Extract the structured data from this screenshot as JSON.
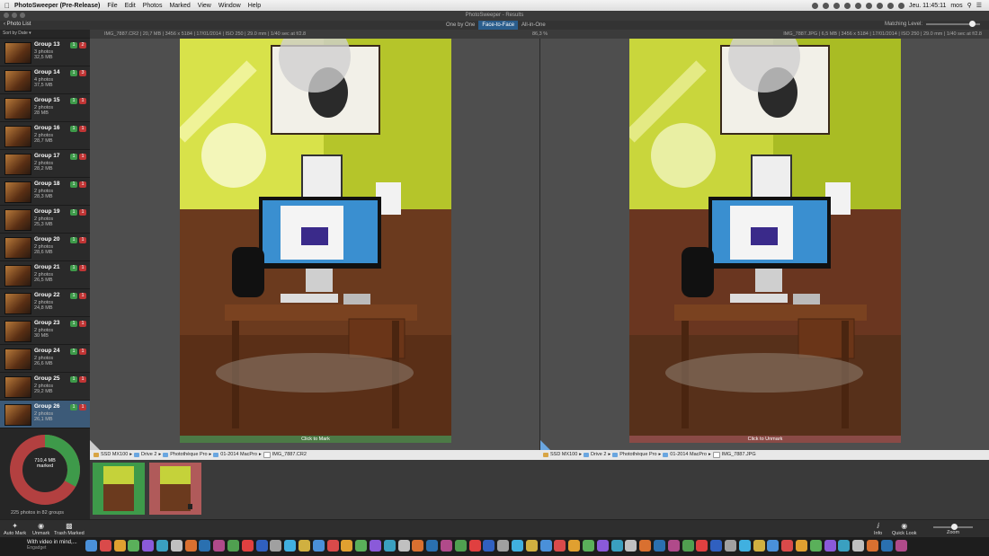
{
  "menubar": {
    "app_name": "PhotoSweeper (Pre-Release)",
    "items": [
      "File",
      "Edit",
      "Photos",
      "Marked",
      "View",
      "Window",
      "Help"
    ],
    "clock": "Jeu. 11:45:11",
    "user": "mos"
  },
  "window": {
    "title": "PhotoSweeper - Results"
  },
  "toolbar": {
    "back_label": "Photo List",
    "modes": [
      "One by One",
      "Face-to-Face",
      "All-in-One"
    ],
    "active_mode": "Face-to-Face",
    "matching_label": "Matching Level:",
    "matching_level": 0.85
  },
  "sidebar": {
    "sort_label": "Sort by Date",
    "groups": [
      {
        "name": "Group 13",
        "count": "3 photos",
        "size": "32,5 MB",
        "keep": "1",
        "trash": "2"
      },
      {
        "name": "Group 14",
        "count": "4 photos",
        "size": "37,5 MB",
        "keep": "1",
        "trash": "3"
      },
      {
        "name": "Group 15",
        "count": "2 photos",
        "size": "28 MB",
        "keep": "1",
        "trash": "1"
      },
      {
        "name": "Group 16",
        "count": "2 photos",
        "size": "28,7 MB",
        "keep": "1",
        "trash": "1"
      },
      {
        "name": "Group 17",
        "count": "2 photos",
        "size": "28,2 MB",
        "keep": "1",
        "trash": "1"
      },
      {
        "name": "Group 18",
        "count": "2 photos",
        "size": "28,3 MB",
        "keep": "1",
        "trash": "1"
      },
      {
        "name": "Group 19",
        "count": "2 photos",
        "size": "25,3 MB",
        "keep": "1",
        "trash": "1"
      },
      {
        "name": "Group 20",
        "count": "2 photos",
        "size": "28,6 MB",
        "keep": "1",
        "trash": "1"
      },
      {
        "name": "Group 21",
        "count": "2 photos",
        "size": "26,5 MB",
        "keep": "1",
        "trash": "1"
      },
      {
        "name": "Group 22",
        "count": "2 photos",
        "size": "24,8 MB",
        "keep": "1",
        "trash": "1"
      },
      {
        "name": "Group 23",
        "count": "2 photos",
        "size": "30 MB",
        "keep": "1",
        "trash": "1"
      },
      {
        "name": "Group 24",
        "count": "2 photos",
        "size": "26,6 MB",
        "keep": "1",
        "trash": "1"
      },
      {
        "name": "Group 25",
        "count": "2 photos",
        "size": "29,2 MB",
        "keep": "1",
        "trash": "1"
      },
      {
        "name": "Group 26",
        "count": "2 photos",
        "size": "26,1 MB",
        "keep": "1",
        "trash": "1"
      }
    ],
    "selected_group": "Group 26",
    "marked_size": "710,4 MB",
    "marked_label": "marked",
    "marked_fraction": 0.33,
    "footer": "225 photos in 82 groups"
  },
  "infobar": {
    "left": "IMG_7887.CR2 | 20,7 MB | 3456 x 5184 | 17/01/2014 | ISO 250 | 29.0 mm | 1/40 sec at f/2.8",
    "zoom": "86,3 %",
    "right": "IMG_7887.JPG | 6,5 MB | 3456 x 5184 | 17/01/2014 | ISO 250 | 29.0 mm | 1/40 sec at f/2.8"
  },
  "panes": {
    "left_action": "Click to Mark",
    "right_action": "Click to Unmark"
  },
  "path_left": [
    "SSD MX100",
    "Drive 2",
    "Photothèque Pro",
    "01-2014 MacPro",
    "IMG_7887.CR2"
  ],
  "path_right": [
    "SSD MX100",
    "Drive 2",
    "Photothèque Pro",
    "01-2014 MacPro",
    "IMG_7887.JPG"
  ],
  "bottom_tools": {
    "auto_mark": "Auto Mark",
    "unmark": "Unmark",
    "trash_marked": "Trash Marked",
    "info": "Info",
    "quick_look": "Quick Look",
    "zoom": "Zoom"
  },
  "dock": {
    "notification_title": "With video in mind,...",
    "notification_source": "Engadget"
  },
  "colors": {
    "keep_green": "#3e9a4a",
    "trash_red": "#c03535",
    "accent_blue": "#2a5d8c"
  }
}
